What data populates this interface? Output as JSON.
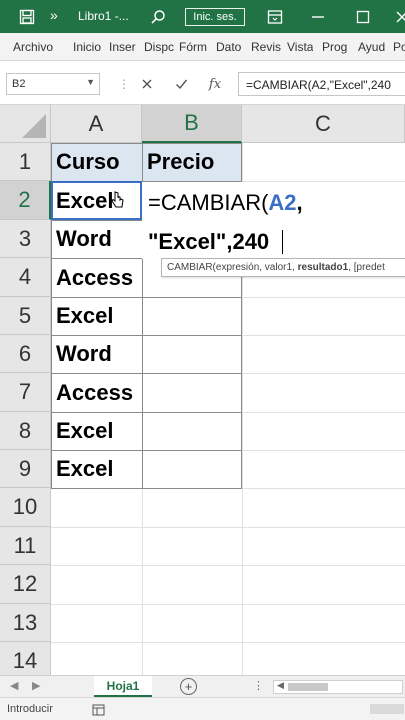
{
  "window": {
    "file_name": "Libro1 -...",
    "signin_label": "Inic. ses.",
    "nav_glyph": "»"
  },
  "ribbon": {
    "tabs": [
      "Archivo",
      "Inicio",
      "Inser",
      "Dispc",
      "Fórm",
      "Dato",
      "Revis",
      "Vista",
      "Prog",
      "Ayud",
      "Po"
    ]
  },
  "formula_bar": {
    "name_box": "B2",
    "fx_label": "fx",
    "formula": "=CAMBIAR(A2,\"Excel\",240"
  },
  "columns": [
    "A",
    "B",
    "C"
  ],
  "rows": [
    "1",
    "2",
    "3",
    "4",
    "5",
    "6",
    "7",
    "8",
    "9",
    "10",
    "11",
    "12",
    "13",
    "14"
  ],
  "cells": {
    "A1": "Curso",
    "B1": "Precio",
    "A2": "Excel",
    "A3": "Word",
    "A4": "Access",
    "A5": "Excel",
    "A6": "Word",
    "A7": "Access",
    "A8": "Excel",
    "A9": "Excel"
  },
  "editor": {
    "line1_prefix": "=CAMBIAR(",
    "line1_ref": "A2",
    "line1_suffix": ",",
    "line2": "\"Excel\",240"
  },
  "tooltip": {
    "prefix": "CAMBIAR(expresión, valor1, ",
    "bold": "resultado1",
    "suffix": ", [predet"
  },
  "sheets": {
    "active": "Hoja1",
    "add_label": "+"
  },
  "status": {
    "mode": "Introducir"
  },
  "colors": {
    "brand": "#217346",
    "header_fill": "#dce6f1",
    "ref_blue": "#3a6fc5"
  }
}
